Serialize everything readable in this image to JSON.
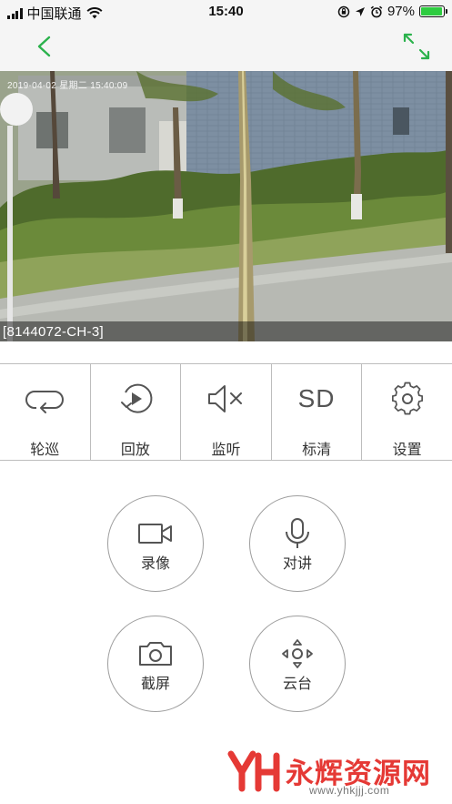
{
  "status_bar": {
    "carrier": "中国联通",
    "time": "15:40",
    "battery_percent": "97%",
    "battery_level": 0.97,
    "icons": [
      "signal-icon",
      "wifi-icon",
      "orientation-lock-icon",
      "location-icon",
      "alarm-icon",
      "battery-icon"
    ]
  },
  "nav": {
    "back_icon": "chevron-left-icon",
    "fullscreen_icon": "expand-icon",
    "accent_color": "#2bb24c"
  },
  "video": {
    "osd_timestamp": "2019-04-02 星期二 15:40:09",
    "channel_label": "[8144072-CH-3]"
  },
  "toolbar": {
    "items": [
      {
        "label": "轮巡",
        "icon": "loop-icon"
      },
      {
        "label": "回放",
        "icon": "playback-icon"
      },
      {
        "label": "监听",
        "icon": "speaker-muted-icon"
      },
      {
        "label": "标清",
        "icon_text": "SD"
      },
      {
        "label": "设置",
        "icon": "gear-icon"
      }
    ]
  },
  "actions": {
    "record": {
      "label": "录像",
      "icon": "video-camera-icon"
    },
    "talk": {
      "label": "对讲",
      "icon": "microphone-icon"
    },
    "screenshot": {
      "label": "截屏",
      "icon": "camera-icon"
    },
    "ptz": {
      "label": "云台",
      "icon": "ptz-direction-icon"
    }
  },
  "watermark": {
    "title": "永辉资源网",
    "url": "www.yhkjjj.com",
    "color": "#e53935"
  }
}
